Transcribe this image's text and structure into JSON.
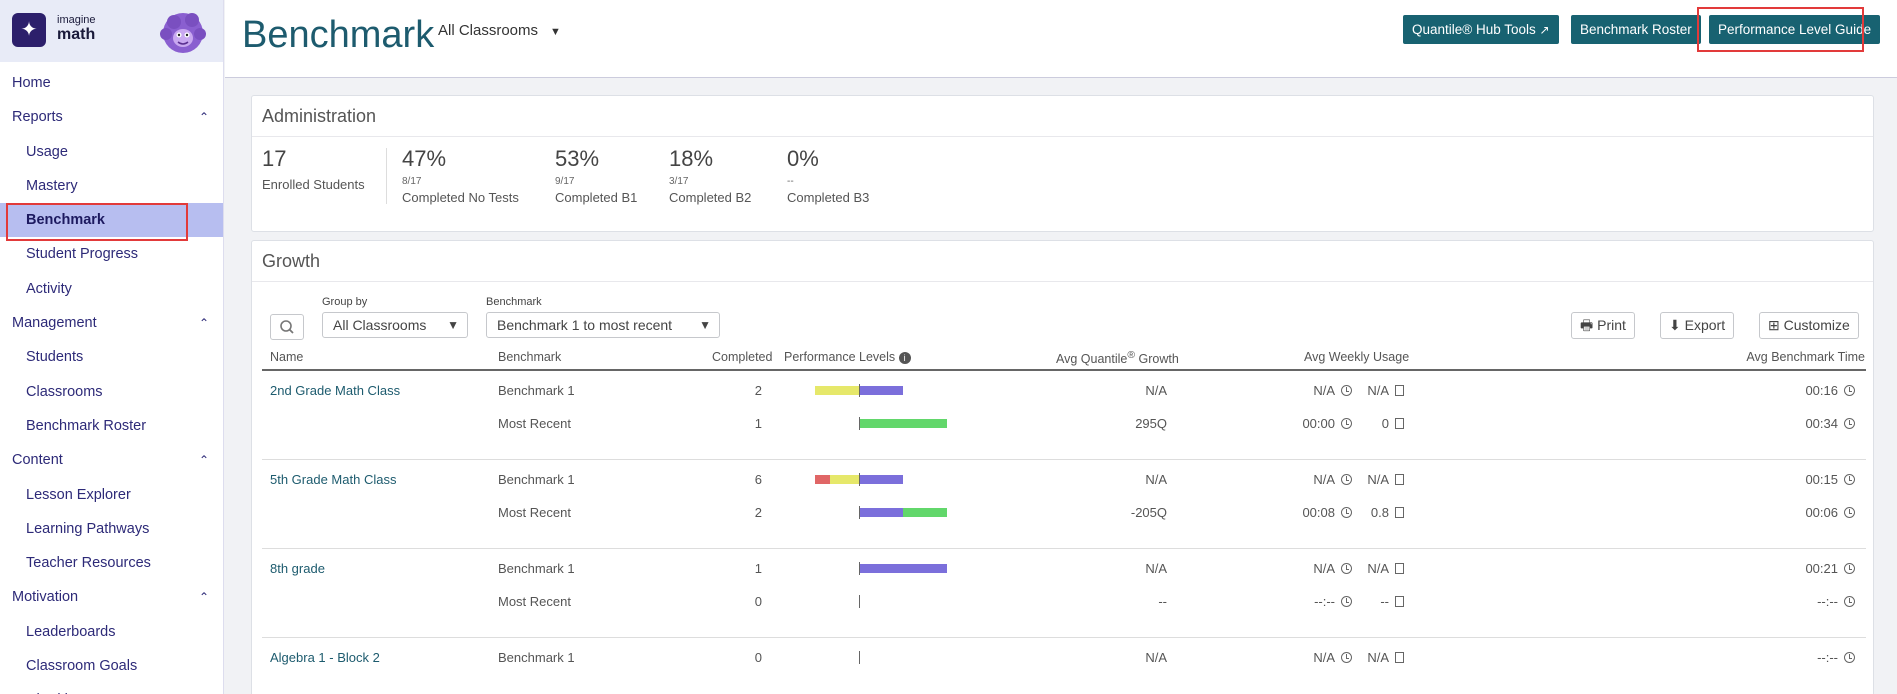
{
  "sidebar": {
    "logo_line1": "imagine",
    "logo_line2": "math",
    "items": [
      {
        "label": "Home",
        "type": "top"
      },
      {
        "label": "Reports",
        "type": "section"
      },
      {
        "label": "Usage",
        "type": "sub"
      },
      {
        "label": "Mastery",
        "type": "sub"
      },
      {
        "label": "Benchmark",
        "type": "sub",
        "active": true
      },
      {
        "label": "Student Progress",
        "type": "sub"
      },
      {
        "label": "Activity",
        "type": "sub"
      },
      {
        "label": "Management",
        "type": "section"
      },
      {
        "label": "Students",
        "type": "sub"
      },
      {
        "label": "Classrooms",
        "type": "sub"
      },
      {
        "label": "Benchmark Roster",
        "type": "sub"
      },
      {
        "label": "Content",
        "type": "section"
      },
      {
        "label": "Lesson Explorer",
        "type": "sub"
      },
      {
        "label": "Learning Pathways",
        "type": "sub"
      },
      {
        "label": "Teacher Resources",
        "type": "sub"
      },
      {
        "label": "Motivation",
        "type": "section"
      },
      {
        "label": "Leaderboards",
        "type": "sub"
      },
      {
        "label": "Classroom Goals",
        "type": "sub"
      },
      {
        "label": "Charities",
        "type": "sub"
      }
    ]
  },
  "header": {
    "title": "Benchmark",
    "classroom_select": "All Classrooms",
    "btn_quantile": "Quantile® Hub Tools",
    "btn_roster": "Benchmark Roster",
    "btn_guide": "Performance Level Guide"
  },
  "administration": {
    "title": "Administration",
    "enrolled_value": "17",
    "enrolled_label": "Enrolled Students",
    "stats": [
      {
        "big": "47%",
        "small": "8/17",
        "label": "Completed No Tests"
      },
      {
        "big": "53%",
        "small": "9/17",
        "label": "Completed B1"
      },
      {
        "big": "18%",
        "small": "3/17",
        "label": "Completed B2"
      },
      {
        "big": "0%",
        "small": "--",
        "label": "Completed B3"
      }
    ]
  },
  "growth": {
    "title": "Growth",
    "group_by_label": "Group by",
    "group_by_value": "All Classrooms",
    "benchmark_label": "Benchmark",
    "benchmark_value": "Benchmark 1 to most recent",
    "btn_print": "Print",
    "btn_export": "Export",
    "btn_customize": "Customize",
    "columns": {
      "name": "Name",
      "benchmark": "Benchmark",
      "completed": "Completed",
      "performance": "Performance Levels",
      "growth": "Avg Quantile",
      "growth_sup": "®",
      "growth_suffix": " Growth",
      "usage": "Avg Weekly Usage",
      "time": "Avg Benchmark Time"
    },
    "colors": {
      "red": "#e06666",
      "yellow": "#e6e86a",
      "blue": "#7b6fdb",
      "green": "#62d76b"
    },
    "rows": [
      {
        "name": "2nd Grade Math Class",
        "lines": [
          {
            "benchmark": "Benchmark 1",
            "completed": "2",
            "growth": "N/A",
            "usage_time": "N/A",
            "usage_count": "N/A",
            "time": "00:16",
            "bars": {
              "red": 0,
              "yellow": 0.5,
              "blue": 0.5,
              "green": 0
            }
          },
          {
            "benchmark": "Most Recent",
            "completed": "1",
            "growth": "295Q",
            "usage_time": "00:00",
            "usage_count": "0",
            "time": "00:34",
            "bars": {
              "red": 0,
              "yellow": 0,
              "blue": 0,
              "green": 1
            }
          }
        ]
      },
      {
        "name": "5th Grade Math Class",
        "lines": [
          {
            "benchmark": "Benchmark 1",
            "completed": "6",
            "growth": "N/A",
            "usage_time": "N/A",
            "usage_count": "N/A",
            "time": "00:15",
            "bars": {
              "red": 0.17,
              "yellow": 0.33,
              "blue": 0.5,
              "green": 0
            }
          },
          {
            "benchmark": "Most Recent",
            "completed": "2",
            "growth": "-205Q",
            "usage_time": "00:08",
            "usage_count": "0.8",
            "time": "00:06",
            "bars": {
              "red": 0,
              "yellow": 0,
              "blue": 0.5,
              "green": 0.5
            }
          }
        ]
      },
      {
        "name": "8th grade",
        "lines": [
          {
            "benchmark": "Benchmark 1",
            "completed": "1",
            "growth": "N/A",
            "usage_time": "N/A",
            "usage_count": "N/A",
            "time": "00:21",
            "bars": {
              "red": 0,
              "yellow": 0,
              "blue": 1,
              "green": 0
            }
          },
          {
            "benchmark": "Most Recent",
            "completed": "0",
            "growth": "--",
            "usage_time": "--:--",
            "usage_count": "--",
            "time": "--:--",
            "bars": {
              "red": 0,
              "yellow": 0,
              "blue": 0,
              "green": 0
            }
          }
        ]
      },
      {
        "name": "Algebra 1 - Block 2",
        "lines": [
          {
            "benchmark": "Benchmark 1",
            "completed": "0",
            "growth": "N/A",
            "usage_time": "N/A",
            "usage_count": "N/A",
            "time": "--:--",
            "bars": {
              "red": 0,
              "yellow": 0,
              "blue": 0,
              "green": 0
            }
          }
        ]
      }
    ]
  }
}
